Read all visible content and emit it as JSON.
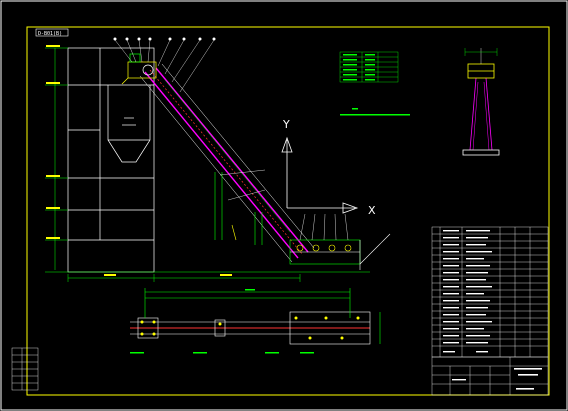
{
  "drawing": {
    "title_tag": "D-B01(B)",
    "axis_y": "Y",
    "axis_x": "X",
    "colors": {
      "background": "#000000",
      "frame": "#ffff00",
      "line_white": "#ffffff",
      "line_green": "#00ff00",
      "line_cyan": "#00ffff",
      "line_magenta": "#ff00ff",
      "line_red": "#ff3333"
    }
  }
}
